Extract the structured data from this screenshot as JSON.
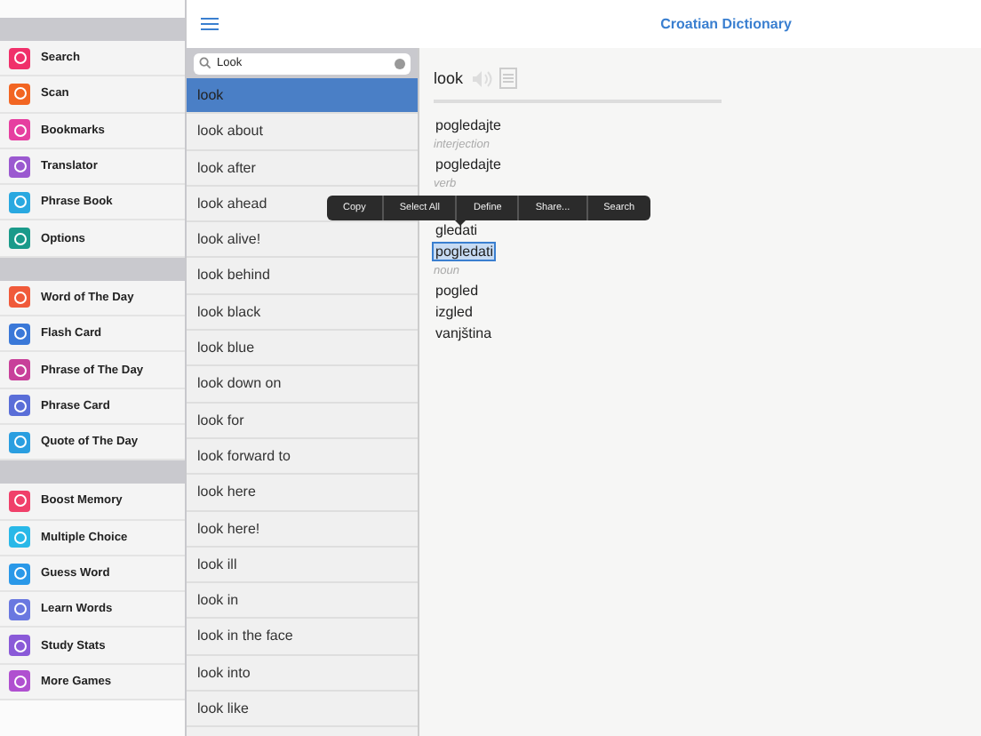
{
  "title": "Croatian Dictionary",
  "sidebar": {
    "sections": [
      {
        "items": [
          {
            "label": "Search",
            "color": "#f0306a"
          },
          {
            "label": "Scan",
            "color": "#f26522"
          },
          {
            "label": "Bookmarks",
            "color": "#e63fa0"
          },
          {
            "label": "Translator",
            "color": "#9b59d0"
          },
          {
            "label": "Phrase Book",
            "color": "#29a8e0"
          },
          {
            "label": "Options",
            "color": "#1a9a8a"
          }
        ]
      },
      {
        "items": [
          {
            "label": "Word of The Day",
            "color": "#f05a3a"
          },
          {
            "label": "Flash Card",
            "color": "#3a78d8"
          },
          {
            "label": "Phrase of The Day",
            "color": "#c8409a"
          },
          {
            "label": "Phrase Card",
            "color": "#5a6ed8"
          },
          {
            "label": "Quote of The Day",
            "color": "#2a9ee0"
          }
        ]
      },
      {
        "items": [
          {
            "label": "Boost Memory",
            "color": "#f0406a"
          },
          {
            "label": "Multiple Choice",
            "color": "#29b8e8"
          },
          {
            "label": "Guess Word",
            "color": "#2a98e8"
          },
          {
            "label": "Learn Words",
            "color": "#6a78e0"
          },
          {
            "label": "Study Stats",
            "color": "#8a5ad8"
          },
          {
            "label": "More Games",
            "color": "#b050d0"
          }
        ]
      }
    ]
  },
  "search": {
    "value": "Look"
  },
  "results": [
    {
      "word": "look",
      "selected": true
    },
    {
      "word": "look about",
      "selected": false
    },
    {
      "word": "look after",
      "selected": false
    },
    {
      "word": "look ahead",
      "selected": false
    },
    {
      "word": "look alive!",
      "selected": false
    },
    {
      "word": "look behind",
      "selected": false
    },
    {
      "word": "look black",
      "selected": false
    },
    {
      "word": "look blue",
      "selected": false
    },
    {
      "word": "look down on",
      "selected": false
    },
    {
      "word": "look for",
      "selected": false
    },
    {
      "word": "look forward to",
      "selected": false
    },
    {
      "word": "look here",
      "selected": false
    },
    {
      "word": "look here!",
      "selected": false
    },
    {
      "word": "look ill",
      "selected": false
    },
    {
      "word": "look in",
      "selected": false
    },
    {
      "word": "look in the face",
      "selected": false
    },
    {
      "word": "look into",
      "selected": false
    },
    {
      "word": "look like",
      "selected": false
    }
  ],
  "entry": {
    "headword": "look",
    "sections": [
      {
        "words": [
          {
            "text": "pogledajte",
            "selected": false
          }
        ]
      },
      {
        "pos": "interjection",
        "words": [
          {
            "text": "pogledajte",
            "selected": false
          }
        ]
      },
      {
        "pos": "verb",
        "words": [
          {
            "text": "gledati",
            "selected": false
          },
          {
            "text": "pogledati",
            "selected": true
          }
        ]
      },
      {
        "pos": "noun",
        "words": [
          {
            "text": "pogled",
            "selected": false
          },
          {
            "text": "izgled",
            "selected": false
          },
          {
            "text": "vanjština",
            "selected": false
          }
        ]
      }
    ]
  },
  "context_menu": [
    "Copy",
    "Select All",
    "Define",
    "Share...",
    "Search"
  ]
}
